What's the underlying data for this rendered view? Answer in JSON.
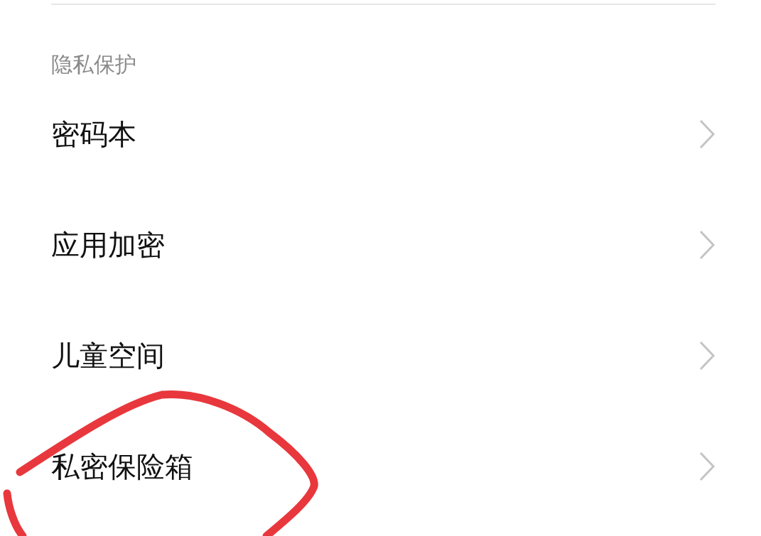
{
  "section": {
    "title": "隐私保护"
  },
  "items": [
    {
      "label": "密码本"
    },
    {
      "label": "应用加密"
    },
    {
      "label": "儿童空间"
    },
    {
      "label": "私密保险箱"
    }
  ]
}
